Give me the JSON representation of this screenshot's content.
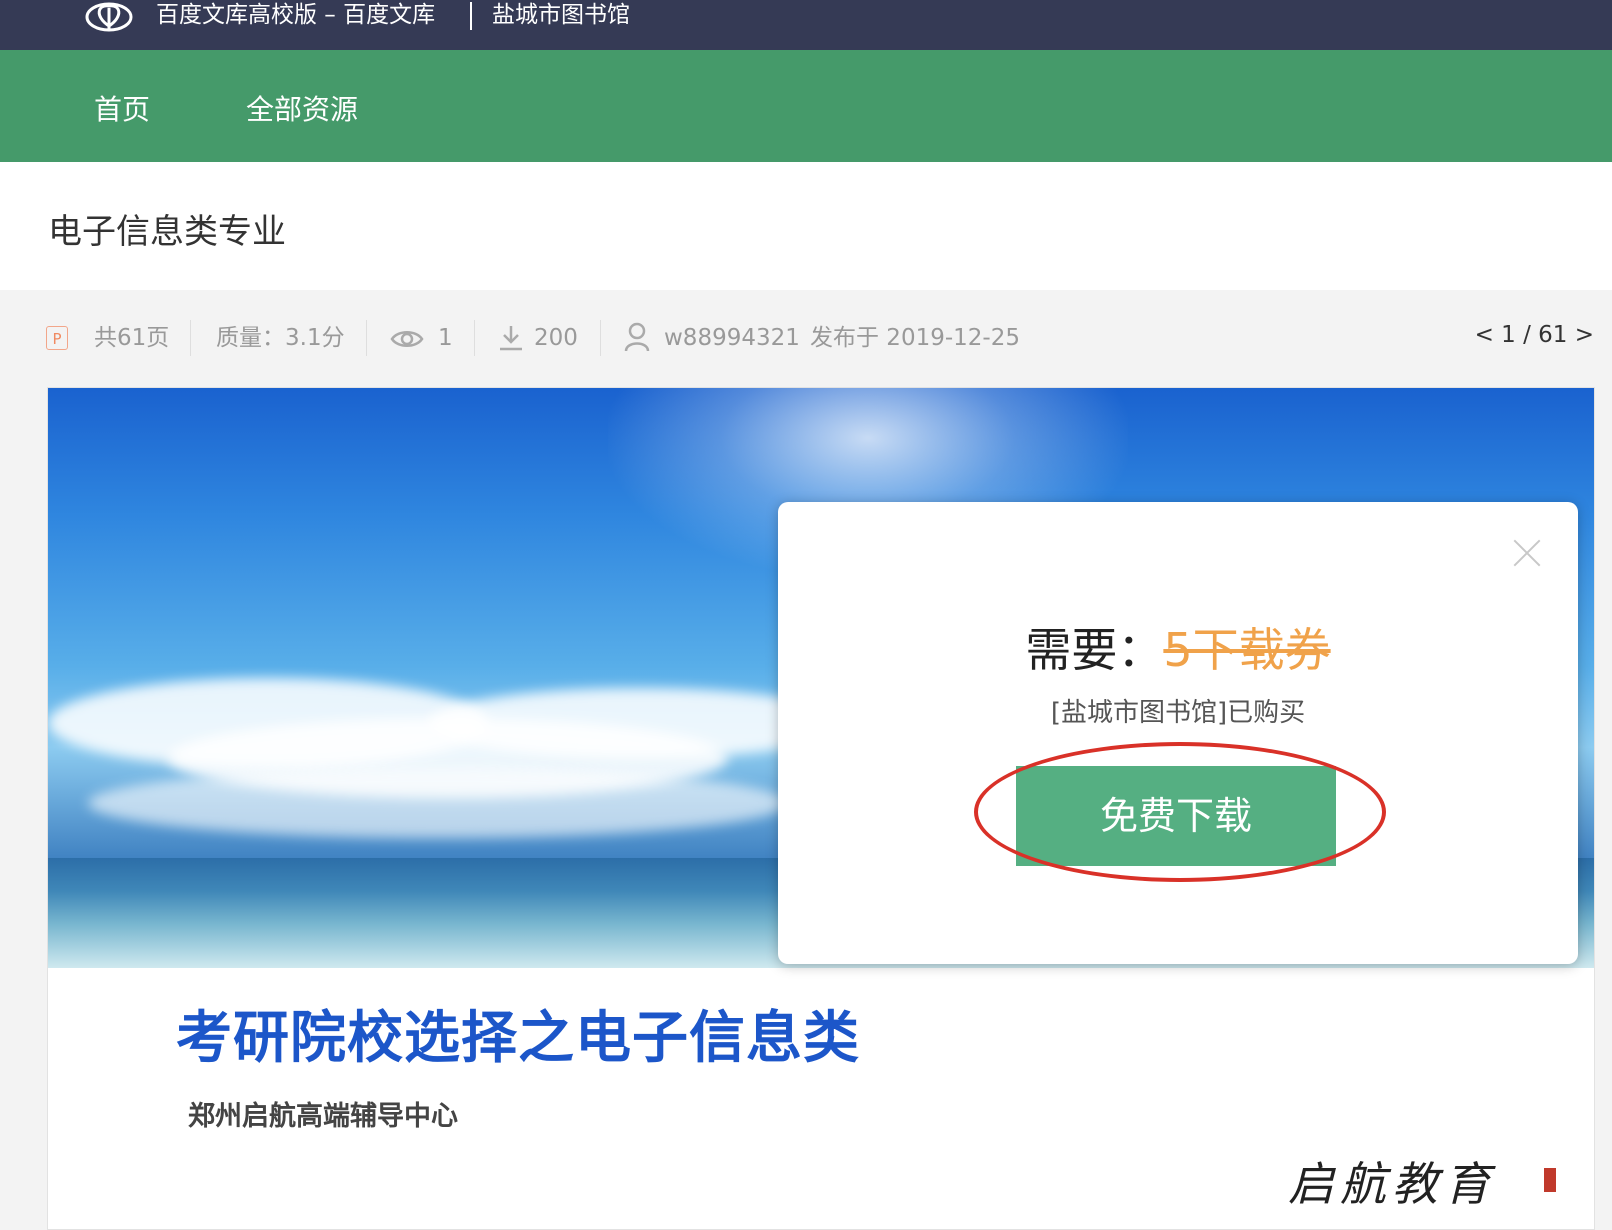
{
  "topbar": {
    "site_title": "百度文库高校版 – 百度文库",
    "library": "盐城市图书馆"
  },
  "nav": {
    "items": [
      {
        "label": "首页"
      },
      {
        "label": "全部资源"
      }
    ]
  },
  "document": {
    "title": "电子信息类专业",
    "file_type_icon": "P",
    "pages": "共61页",
    "quality": "质量：3.1分",
    "views": "1",
    "downloads": "200",
    "author": "w88994321",
    "published": "发布于 2019-12-25",
    "pager": "< 1 / 61 >"
  },
  "slide": {
    "title": "考研院校选择之电子信息类",
    "subtitle": "郑州启航高端辅导中心",
    "brand": "启航教育"
  },
  "popup": {
    "need_label": "需要：",
    "price": "5下载券",
    "bought_note": "[盐城市图书馆]已购买",
    "download_label": "免费下载"
  },
  "icons": {
    "logo": "baidu-wenku-logo",
    "views": "eye-icon",
    "downloads": "download-icon",
    "author": "user-icon",
    "close": "close-icon"
  },
  "colors": {
    "topbar": "#353a55",
    "navbar": "#459a6a",
    "download_button": "#55af82",
    "price": "#f0a24a",
    "annotation": "#d93128"
  }
}
